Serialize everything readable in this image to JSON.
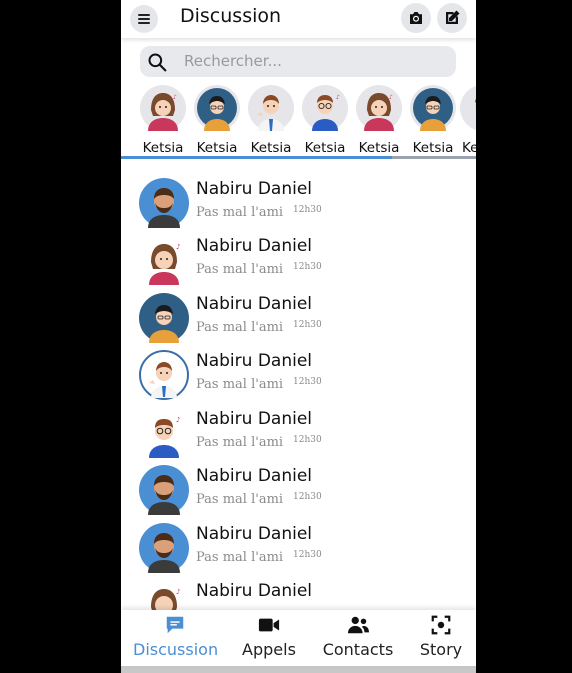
{
  "header": {
    "title": "Discussion",
    "menu_icon": "hamburger-icon",
    "camera_icon": "camera-icon",
    "compose_icon": "edit-icon"
  },
  "search": {
    "placeholder": "Rechercher..."
  },
  "stories": [
    {
      "name": "Ketsia"
    },
    {
      "name": "Ketsia"
    },
    {
      "name": "Ketsia"
    },
    {
      "name": "Ketsia"
    },
    {
      "name": "Ketsia"
    },
    {
      "name": "Ketsia"
    },
    {
      "name": "Ke"
    }
  ],
  "chats": [
    {
      "name": "Nabiru Daniel",
      "message": "Pas mal l'ami",
      "time": "12h30"
    },
    {
      "name": "Nabiru Daniel",
      "message": "Pas mal l'ami",
      "time": "12h30"
    },
    {
      "name": "Nabiru Daniel",
      "message": "Pas mal l'ami",
      "time": "12h30"
    },
    {
      "name": "Nabiru Daniel",
      "message": "Pas mal l'ami",
      "time": "12h30"
    },
    {
      "name": "Nabiru Daniel",
      "message": "Pas mal l'ami",
      "time": "12h30"
    },
    {
      "name": "Nabiru Daniel",
      "message": "Pas mal l'ami",
      "time": "12h30"
    },
    {
      "name": "Nabiru Daniel",
      "message": "Pas mal l'ami",
      "time": "12h30"
    },
    {
      "name": "Nabiru Daniel",
      "message": "",
      "time": ""
    }
  ],
  "nav": {
    "discussion": "Discussion",
    "appels": "Appels",
    "contacts": "Contacts",
    "story": "Story"
  },
  "colors": {
    "accent": "#4a8fd4",
    "surface": "#e4e6ea"
  }
}
